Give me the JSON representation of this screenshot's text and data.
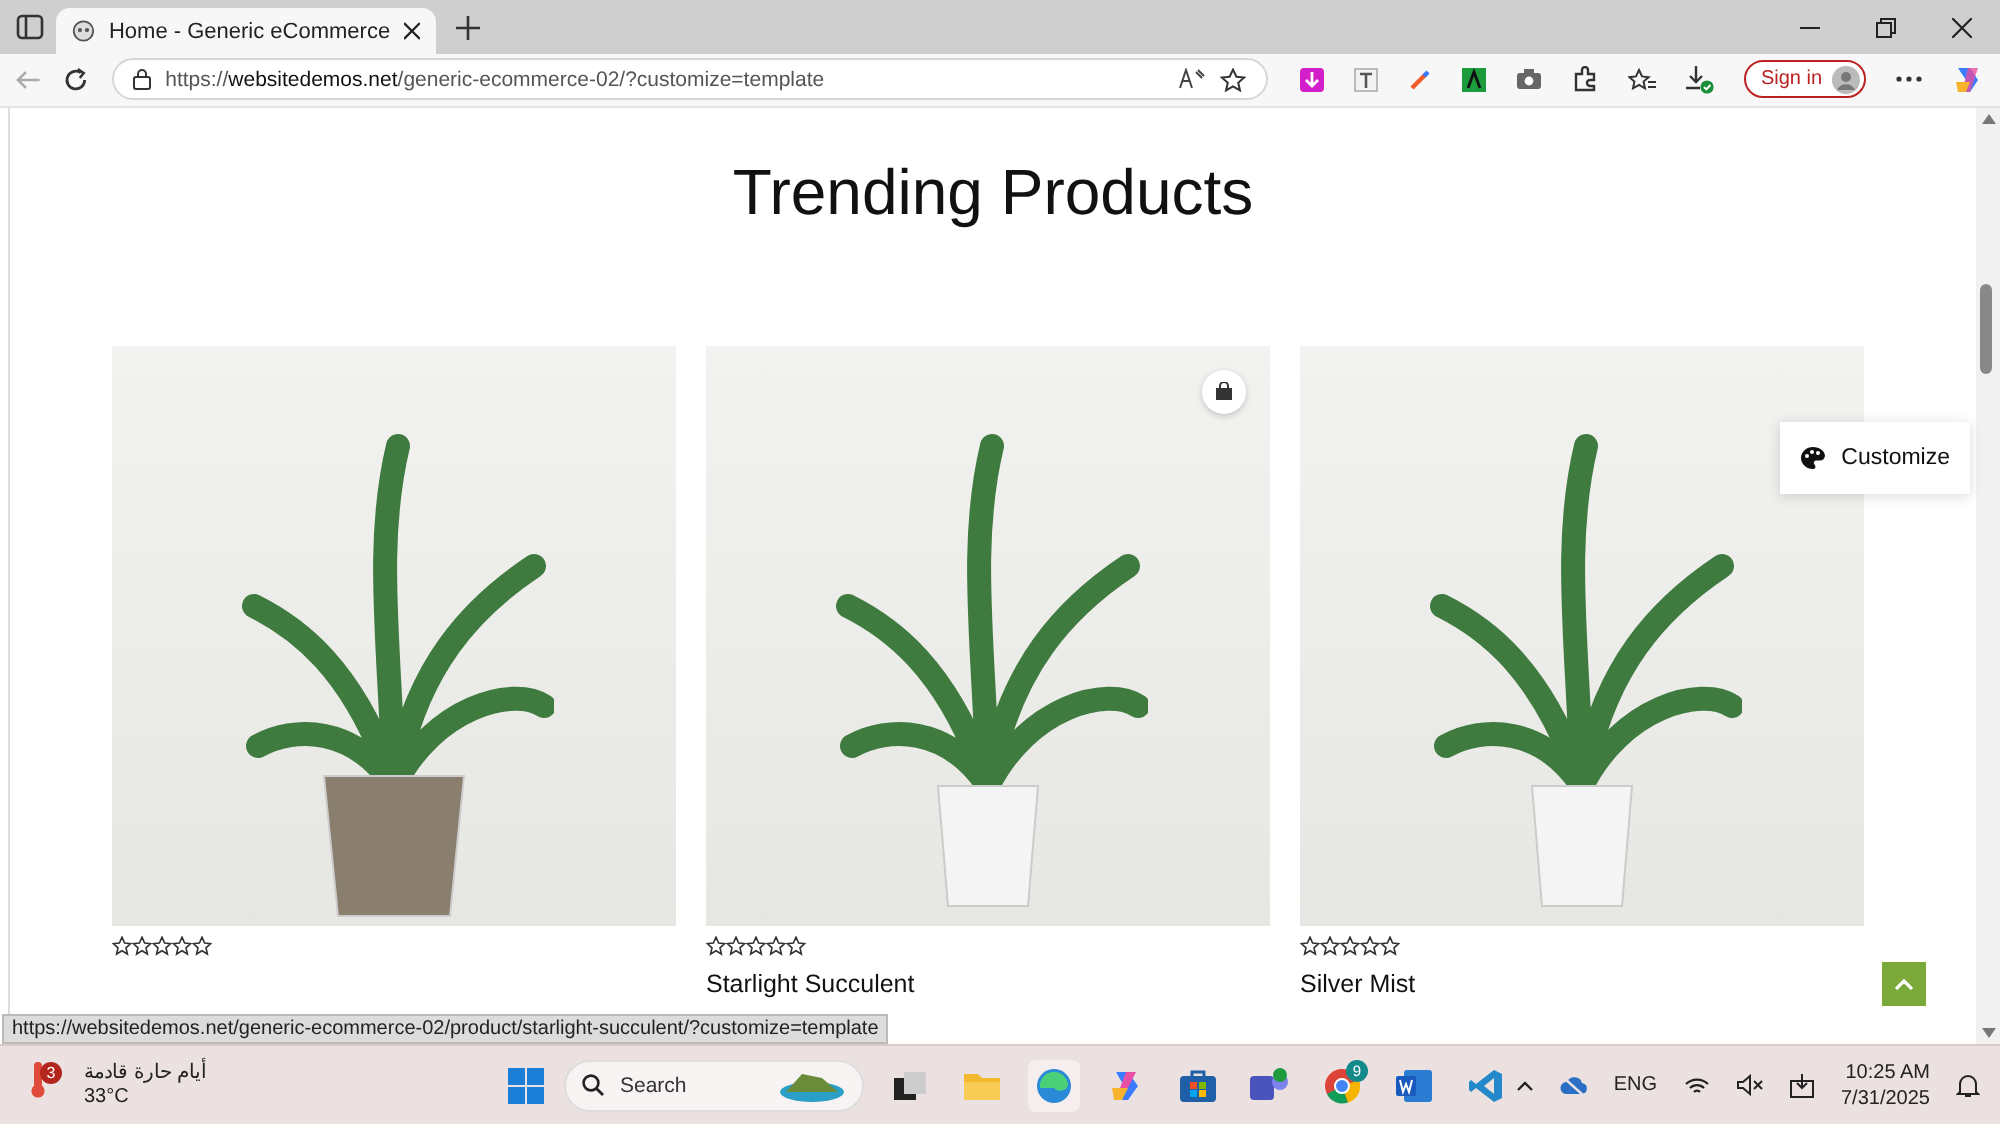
{
  "browser": {
    "tabs": [
      {
        "title": "Home - Generic eCommerce",
        "selected": true
      }
    ],
    "address": "https://**websitedemos.net**/generic-ecommerce-02/?customize=template",
    "sign_in": "Sign in"
  },
  "page": {
    "heading": "Trending Products",
    "customize": "Customize",
    "products": [
      {
        "stars": 0,
        "wishlist": false
      },
      {
        "name": "Starlight Succulent",
        "stars": 0,
        "wishlist": true
      },
      {
        "name": "Silver Mist",
        "stars": 0,
        "wishlist": false
      }
    ]
  },
  "status_url": "https://websitedemos.net/generic-ecommerce-02/product/starlight-succulent/?customize=template",
  "taskbar": {
    "weather": {
      "badge": "3",
      "text": "أيام حارة قادمة",
      "temp": "33°C"
    },
    "search": "Search",
    "chrome_badge": "9",
    "language": "ENG",
    "time": "10:25 AM",
    "date": "7/31/2025"
  }
}
